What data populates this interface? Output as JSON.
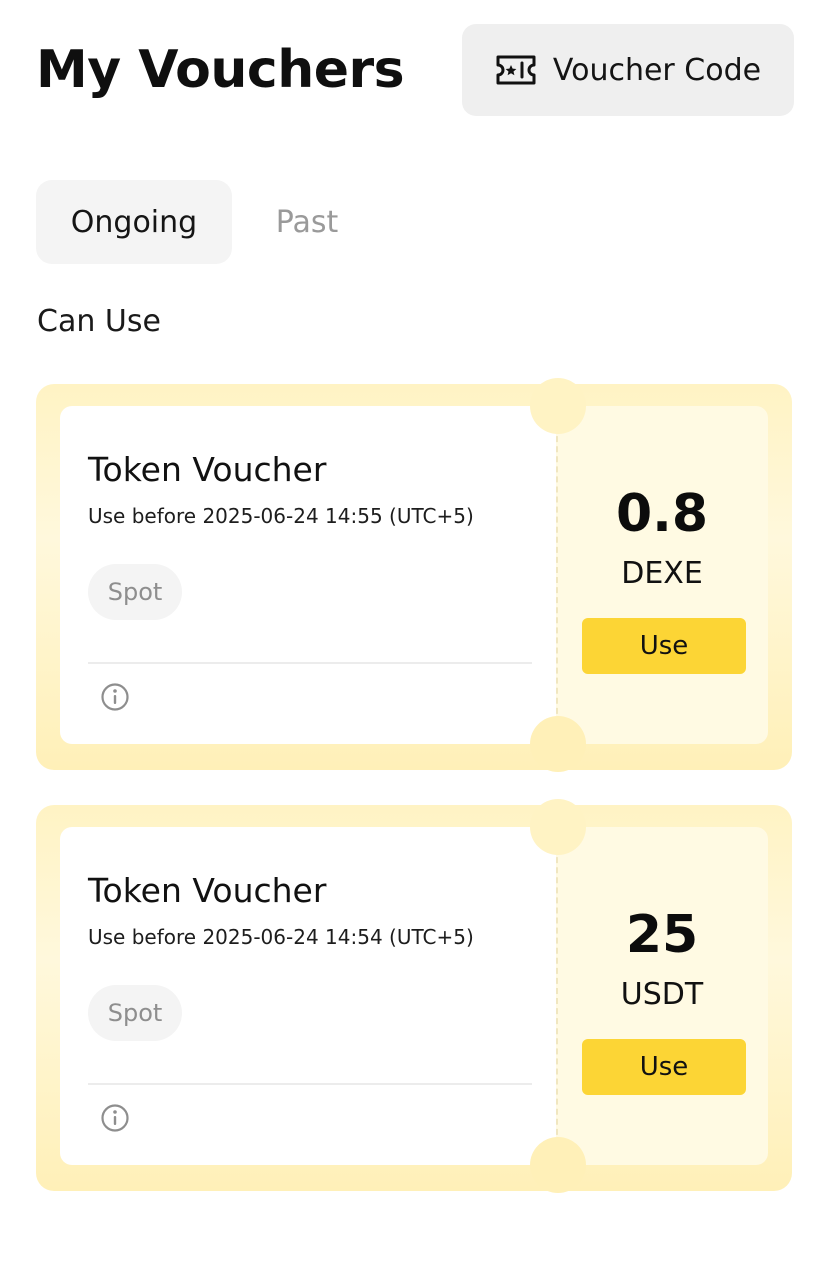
{
  "header": {
    "title": "My Vouchers",
    "voucher_code_label": "Voucher Code",
    "voucher_code_icon": "ticket-star-icon"
  },
  "tabs": [
    {
      "label": "Ongoing",
      "active": true
    },
    {
      "label": "Past",
      "active": false
    }
  ],
  "section": {
    "label": "Can Use"
  },
  "vouchers": [
    {
      "title": "Token Voucher",
      "expiry": "Use before 2025-06-24 14:55 (UTC+5)",
      "tag": "Spot",
      "amount": "0.8",
      "unit": "DEXE",
      "action": "Use",
      "info_icon": "info-icon"
    },
    {
      "title": "Token Voucher",
      "expiry": "Use before 2025-06-24 14:54 (UTC+5)",
      "tag": "Spot",
      "amount": "25",
      "unit": "USDT",
      "action": "Use",
      "info_icon": "info-icon"
    }
  ],
  "colors": {
    "accent": "#fcd535",
    "card_bg": "#fff3c4",
    "tab_active_bg": "#f4f4f4",
    "muted_text": "#9a9a9a"
  }
}
